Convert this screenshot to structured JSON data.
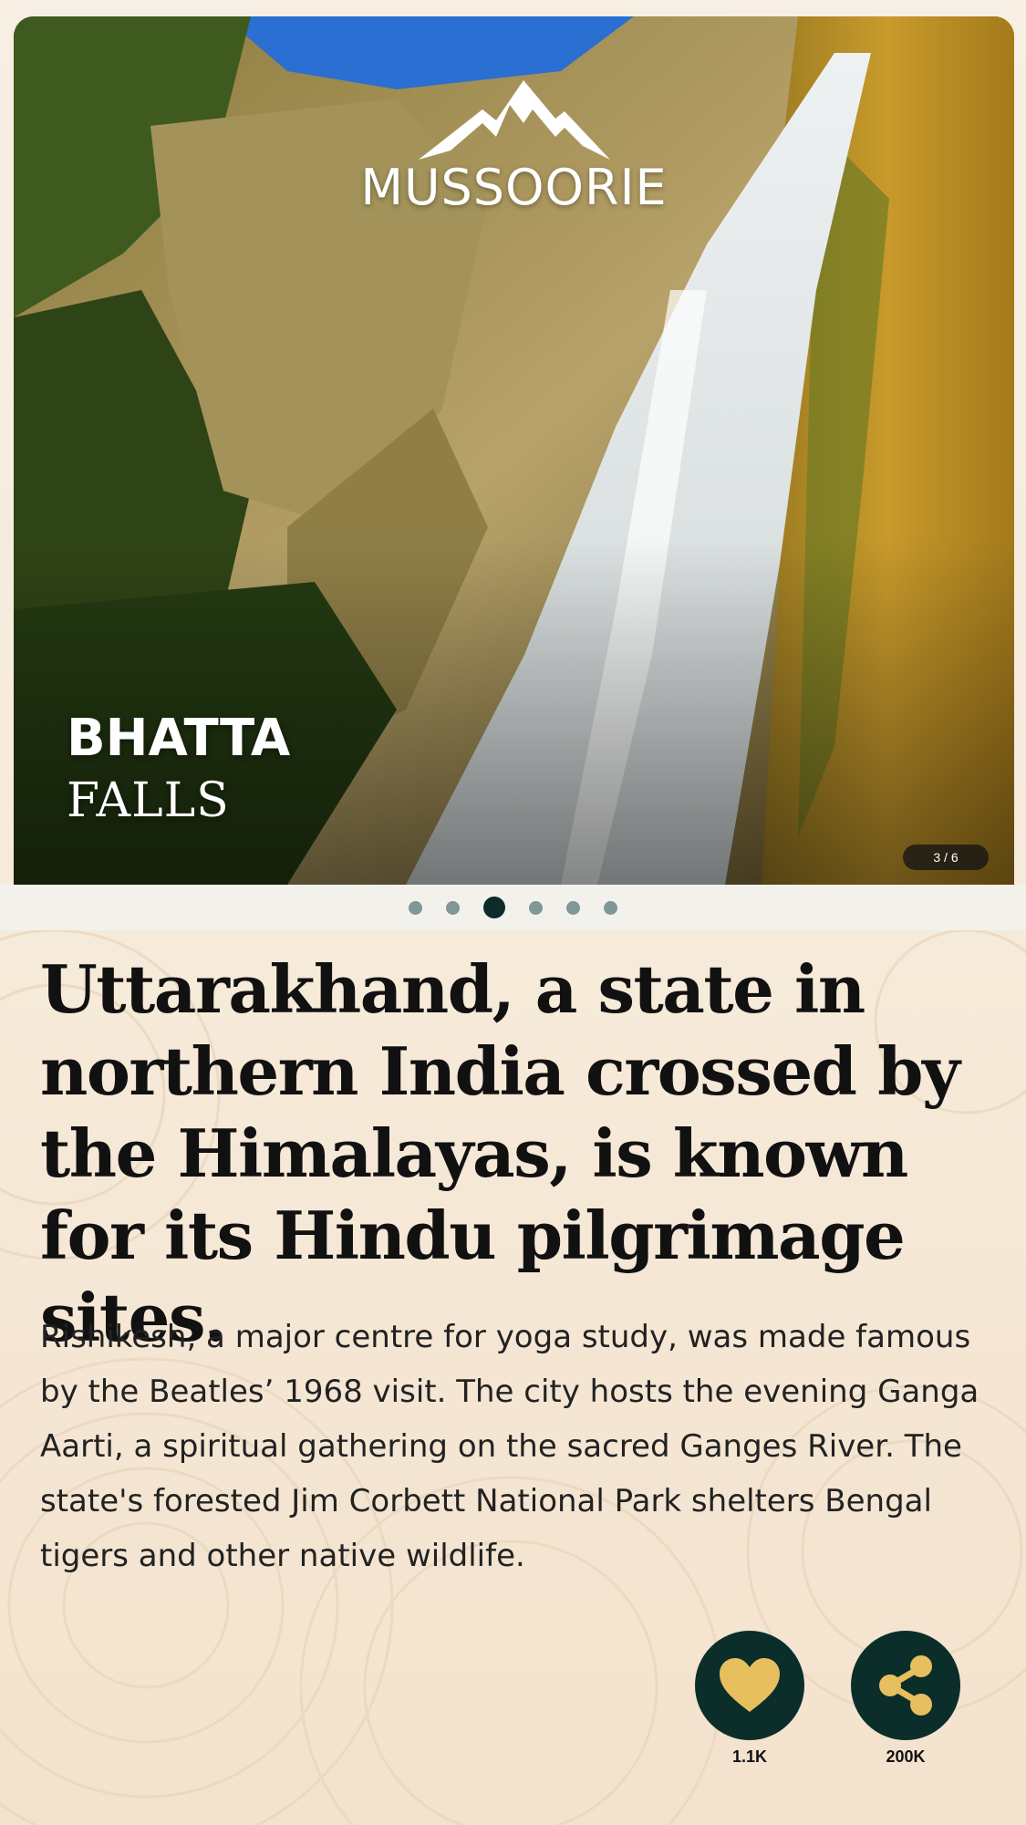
{
  "hero": {
    "brand_name": "MUSSOORIE",
    "title_line1": "BHATTA",
    "title_line2": "FALLS",
    "counter": "3 / 6"
  },
  "pagination": {
    "total": 6,
    "active_index": 3
  },
  "headline": "Uttarakhand, a state in northern India crossed by the Himalayas, is known for its Hindu pilgrimage sites.",
  "body": "Rishikesh, a major centre for yoga study, was made famous by the Beatles’ 1968 visit. The city hosts the evening Ganga Aarti, a spiritual gathering on the sacred Ganges River. The state's forested Jim Corbett National Park shelters Bengal tigers and other native wildlife.",
  "actions": {
    "like": {
      "icon": "heart-icon",
      "count": "1.1K"
    },
    "share": {
      "icon": "share-icon",
      "count": "200K"
    }
  },
  "colors": {
    "accent_dark": "#0b2e2b",
    "icon_gold": "#e8bf5f",
    "background": "#f6e9d8"
  }
}
